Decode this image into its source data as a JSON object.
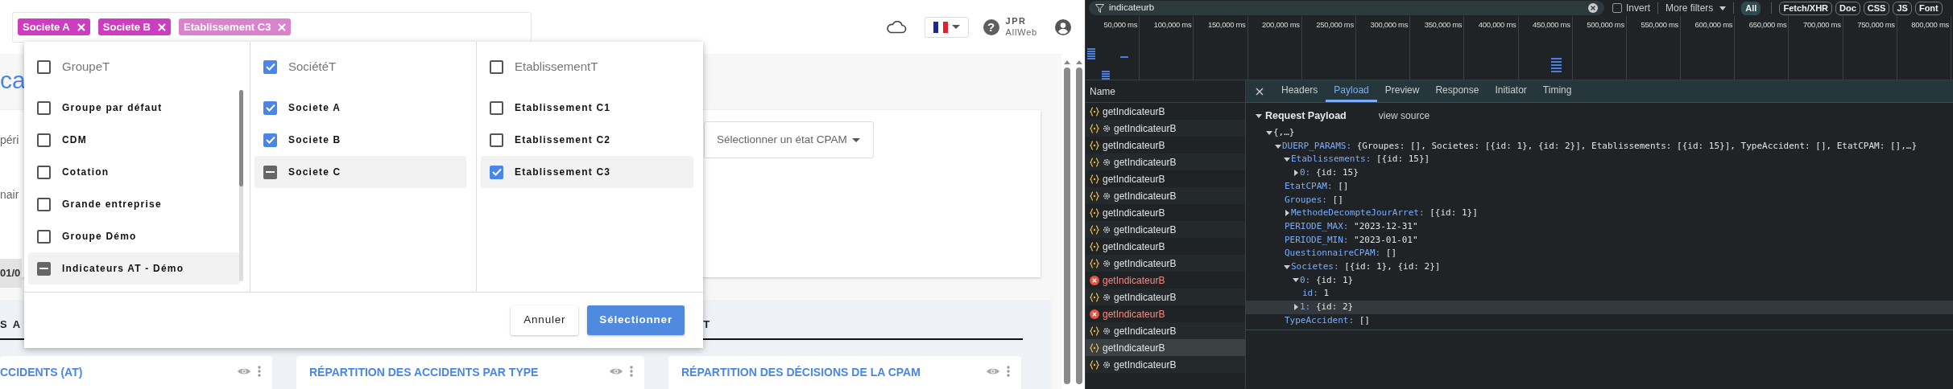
{
  "app": {
    "chips": [
      {
        "label": "Societe A",
        "color": "#cc3dbf"
      },
      {
        "label": "Societe B",
        "color": "#cc3dbf"
      },
      {
        "label": "Etablissement C3",
        "color": "#d983cc"
      }
    ],
    "user": {
      "initials": "JPR",
      "org": "AllWeb"
    },
    "help": "?",
    "page_title": "ca",
    "filter_labels": [
      "péri",
      "nair"
    ],
    "date_value": "01/0",
    "cpam_select": {
      "placeholder": "Sélectionner un état CPAM"
    },
    "section_tabs": [
      "S A",
      "T"
    ],
    "cards": [
      {
        "title": "CCIDENTS (AT)"
      },
      {
        "title": "RÉPARTITION DES ACCIDENTS PAR TYPE"
      },
      {
        "title": "RÉPARTITION DES DÉCISIONS DE LA CPAM"
      }
    ],
    "picker": {
      "columns": [
        {
          "title": "GroupeT",
          "checked": false,
          "indeterminate": false,
          "items": [
            {
              "label": "Groupe par défaut",
              "checked": false,
              "indeterminate": false,
              "highlighted": false
            },
            {
              "label": "CDM",
              "checked": false,
              "indeterminate": false,
              "highlighted": false
            },
            {
              "label": "Cotation",
              "checked": false,
              "indeterminate": false,
              "highlighted": false
            },
            {
              "label": "Grande entreprise",
              "checked": false,
              "indeterminate": false,
              "highlighted": false
            },
            {
              "label": "Groupe Démo",
              "checked": false,
              "indeterminate": false,
              "highlighted": false
            },
            {
              "label": "Indicateurs AT - Démo",
              "checked": false,
              "indeterminate": true,
              "highlighted": true
            }
          ]
        },
        {
          "title": "SociétéT",
          "checked": true,
          "indeterminate": false,
          "items": [
            {
              "label": "Societe A",
              "checked": true,
              "indeterminate": false,
              "highlighted": false
            },
            {
              "label": "Societe B",
              "checked": true,
              "indeterminate": false,
              "highlighted": false
            },
            {
              "label": "Societe C",
              "checked": false,
              "indeterminate": true,
              "highlighted": true
            }
          ]
        },
        {
          "title": "EtablissementT",
          "checked": false,
          "indeterminate": false,
          "items": [
            {
              "label": "Etablissement C1",
              "checked": false,
              "indeterminate": false,
              "highlighted": false
            },
            {
              "label": "Etablissement C2",
              "checked": false,
              "indeterminate": false,
              "highlighted": false
            },
            {
              "label": "Etablissement C3",
              "checked": true,
              "indeterminate": false,
              "highlighted": true
            }
          ]
        }
      ],
      "buttons": [
        {
          "label": "Annuler",
          "kind": "secondary"
        },
        {
          "label": "Sélectionner",
          "kind": "primary"
        }
      ]
    }
  },
  "devtools": {
    "filter": {
      "value": "indicateurb"
    },
    "invert": {
      "label": "Invert",
      "checked": false
    },
    "more_filters": "More filters",
    "type_filters": [
      {
        "label": "All",
        "selected": true
      },
      {
        "label": "Fetch/XHR",
        "selected": false
      },
      {
        "label": "Doc",
        "selected": false
      },
      {
        "label": "CSS",
        "selected": false
      },
      {
        "label": "JS",
        "selected": false
      },
      {
        "label": "Font",
        "selected": false
      }
    ],
    "timeline_ticks": [
      "50,000 ms",
      "100,000 ms",
      "150,000 ms",
      "200,000 ms",
      "250,000 ms",
      "300,000 ms",
      "350,000 ms",
      "400,000 ms",
      "450,000 ms",
      "500,000 ms",
      "550,000 ms",
      "600,000 ms",
      "650,000 ms",
      "700,000 ms",
      "750,000 ms",
      "800,000 ms"
    ],
    "requests": {
      "column": "Name",
      "rows": [
        {
          "name": "getIndicateurB",
          "kind": "json",
          "selected": false
        },
        {
          "name": "getIndicateurB",
          "kind": "gear",
          "selected": false
        },
        {
          "name": "getIndicateurB",
          "kind": "json",
          "selected": false
        },
        {
          "name": "getIndicateurB",
          "kind": "gear",
          "selected": false
        },
        {
          "name": "getIndicateurB",
          "kind": "json",
          "selected": false
        },
        {
          "name": "getIndicateurB",
          "kind": "gear",
          "selected": false
        },
        {
          "name": "getIndicateurB",
          "kind": "json",
          "selected": false
        },
        {
          "name": "getIndicateurB",
          "kind": "gear",
          "selected": false
        },
        {
          "name": "getIndicateurB",
          "kind": "json",
          "selected": false
        },
        {
          "name": "getIndicateurB",
          "kind": "gear",
          "selected": false
        },
        {
          "name": "getIndicateurB",
          "kind": "error",
          "selected": false
        },
        {
          "name": "getIndicateurB",
          "kind": "gear",
          "selected": false
        },
        {
          "name": "getIndicateurB",
          "kind": "error",
          "selected": false
        },
        {
          "name": "getIndicateurB",
          "kind": "gear",
          "selected": false
        },
        {
          "name": "getIndicateurB",
          "kind": "json",
          "selected": true
        },
        {
          "name": "getIndicateurB",
          "kind": "gear",
          "selected": false
        }
      ]
    },
    "detail_tabs": [
      {
        "label": "Headers",
        "selected": false
      },
      {
        "label": "Payload",
        "selected": true
      },
      {
        "label": "Preview",
        "selected": false
      },
      {
        "label": "Response",
        "selected": false
      },
      {
        "label": "Initiator",
        "selected": false
      },
      {
        "label": "Timing",
        "selected": false
      }
    ],
    "payload": {
      "title": "Request Payload",
      "expanded": true,
      "view_source": "view source",
      "tree": [
        {
          "value": "{,…}",
          "expanded": true,
          "selected": false,
          "children": [
            {
              "key": "DUERP_PARAMS:",
              "value": "{Groupes: [], Societes: [{id: 1}, {id: 2}], Etablissements: [{id: 15}], TypeAccident: [], EtatCPAM: [],…}",
              "expanded": true,
              "selected": false,
              "children": [
                {
                  "key": "Etablissements:",
                  "value": "[{id: 15}]",
                  "expanded": true,
                  "selected": false,
                  "children": [
                    {
                      "key": "0:",
                      "value": "{id: 15}",
                      "expanded": false,
                      "selected": false
                    }
                  ]
                },
                {
                  "key": "EtatCPAM:",
                  "value": "[]",
                  "selected": false
                },
                {
                  "key": "Groupes:",
                  "value": "[]",
                  "selected": false
                },
                {
                  "key": "MethodeDecompteJourArret:",
                  "value": "[{id: 1}]",
                  "expanded": false,
                  "selected": false
                },
                {
                  "key": "PERIODE_MAX:",
                  "value": "\"2023-12-31\"",
                  "selected": false
                },
                {
                  "key": "PERIODE_MIN:",
                  "value": "\"2023-01-01\"",
                  "selected": false
                },
                {
                  "key": "QuestionnaireCPAM:",
                  "value": "[]",
                  "selected": false
                },
                {
                  "key": "Societes:",
                  "value": "[{id: 1}, {id: 2}]",
                  "expanded": true,
                  "selected": false,
                  "children": [
                    {
                      "key": "0:",
                      "value": "{id: 1}",
                      "expanded": true,
                      "selected": false,
                      "children": [
                        {
                          "key": "id:",
                          "value": "1",
                          "selected": false
                        }
                      ]
                    },
                    {
                      "key": "1:",
                      "value": "{id: 2}",
                      "expanded": false,
                      "selected": true
                    }
                  ]
                },
                {
                  "key": "TypeAccident:",
                  "value": "[]",
                  "selected": false
                }
              ]
            }
          ]
        }
      ]
    }
  }
}
